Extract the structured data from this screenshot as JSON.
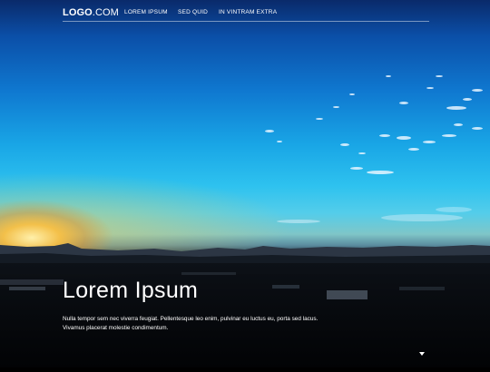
{
  "header": {
    "logo_bold": "LOGO",
    "logo_light": ".COM",
    "nav_items": [
      "LOREM IPSUM",
      "SED QUID",
      "IN VINTRAM EXTRA"
    ]
  },
  "hero": {
    "title": "Lorem Ipsum",
    "text_line1": "Nulla tempor sem nec viverra feugiat. Pellentesque leo enim, pulvinar eu luctus eu, porta sed lacus.",
    "text_line2": "Vivamus placerat molestie condimentum."
  },
  "icons": {
    "scroll": "chevron-down-icon"
  },
  "colors": {
    "text": "#ffffff",
    "sky_top": "#0a2a6a",
    "sky_mid": "#19a6e6",
    "sun": "#ffbe3c"
  }
}
